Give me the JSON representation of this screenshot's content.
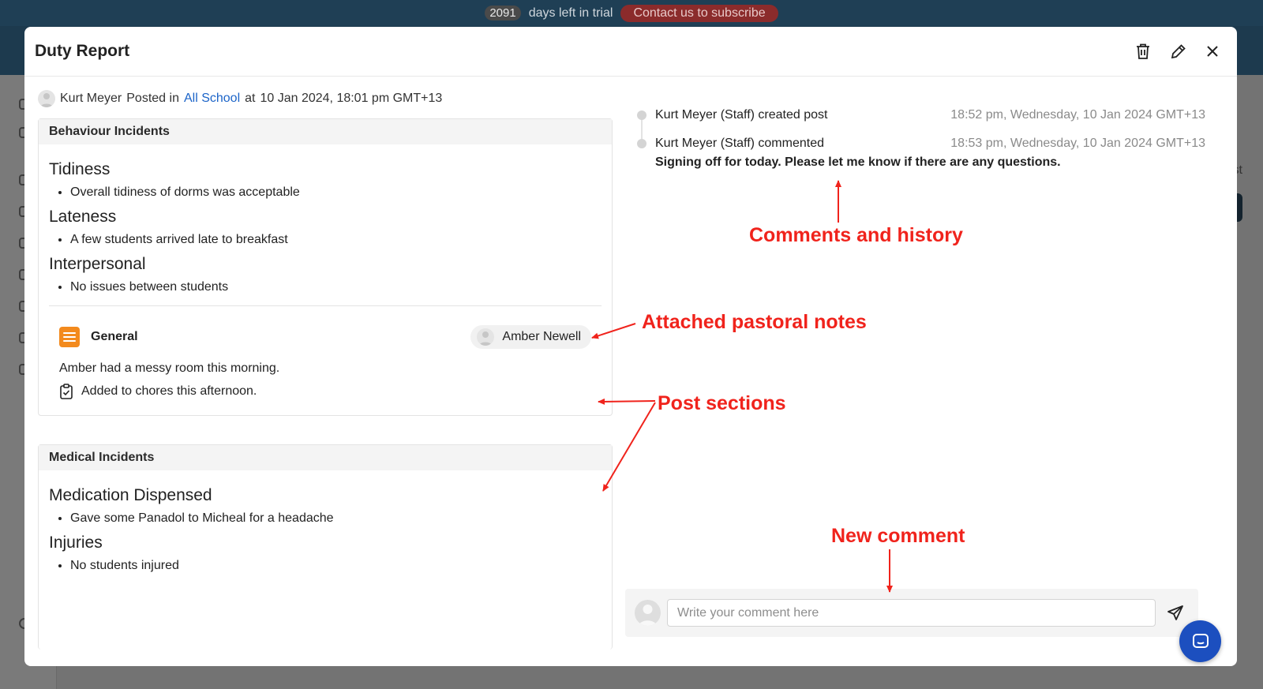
{
  "trial_banner": {
    "days": "2091",
    "text": "days left in trial",
    "cta": "Contact us to subscribe"
  },
  "background": {
    "partial_text": "st"
  },
  "modal": {
    "title": "Duty Report",
    "actions": [
      "delete",
      "edit",
      "close"
    ]
  },
  "post": {
    "author": "Kurt Meyer",
    "posted_in_label": "Posted in",
    "channel": "All School",
    "at_label": "at",
    "timestamp": "10 Jan 2024, 18:01 pm GMT+13"
  },
  "sections": [
    {
      "title": "Behaviour Incidents",
      "items": [
        {
          "title": "Tidiness",
          "bullets": [
            "Overall tidiness of dorms was acceptable"
          ]
        },
        {
          "title": "Lateness",
          "bullets": [
            "A few students arrived late to breakfast"
          ]
        },
        {
          "title": "Interpersonal",
          "bullets": [
            "No issues between students"
          ]
        }
      ],
      "note": {
        "category": "General",
        "student": "Amber Newell",
        "text": "Amber had a messy room this morning.",
        "action": "Added to chores this afternoon."
      }
    },
    {
      "title": "Medical Incidents",
      "items": [
        {
          "title": "Medication Dispensed",
          "bullets": [
            "Gave some Panadol to Micheal for a headache"
          ]
        },
        {
          "title": "Injuries",
          "bullets": [
            "No students injured"
          ]
        }
      ]
    }
  ],
  "history": [
    {
      "text": "Kurt Meyer (Staff) created post",
      "time": "18:52 pm, Wednesday, 10 Jan 2024 GMT+13"
    },
    {
      "text": "Kurt Meyer (Staff) commented",
      "time": "18:53 pm, Wednesday, 10 Jan 2024 GMT+13",
      "comment": "Signing off for today. Please let me know if there are any questions."
    }
  ],
  "comment_box": {
    "placeholder": "Write your comment here"
  },
  "annotations": {
    "comments_history": "Comments and history",
    "pastoral_notes": "Attached pastoral notes",
    "post_sections": "Post sections",
    "new_comment": "New comment"
  },
  "colors": {
    "accent_link": "#1c64c8",
    "note_icon": "#f38a1d",
    "annotation": "#f0231c",
    "trial_cta": "#8b2b2b",
    "chat_fab": "#1c4fbf"
  }
}
